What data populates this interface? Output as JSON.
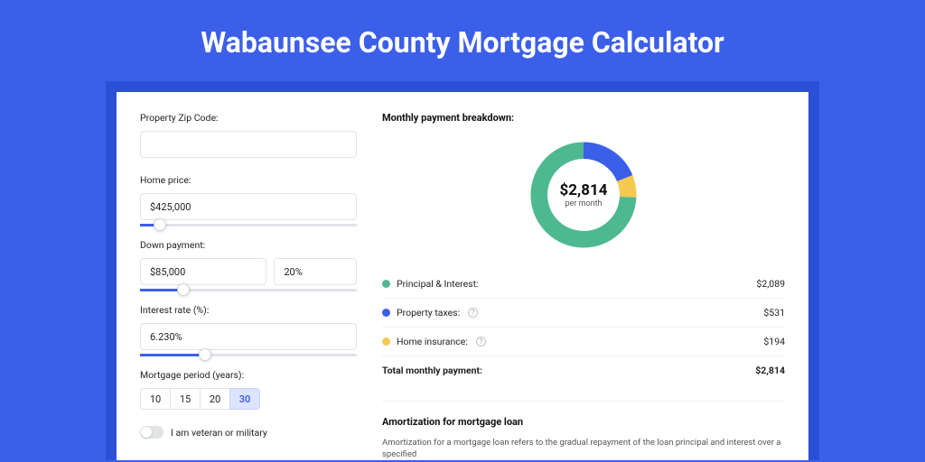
{
  "page_title": "Wabaunsee County Mortgage Calculator",
  "form": {
    "zip_label": "Property Zip Code:",
    "zip_value": "",
    "home_price_label": "Home price:",
    "home_price_value": "$425,000",
    "home_price_slider_pct": 9,
    "down_payment_label": "Down payment:",
    "down_payment_value": "$85,000",
    "down_payment_pct_value": "20%",
    "down_payment_slider_pct": 20,
    "interest_label": "Interest rate (%):",
    "interest_value": "6.230%",
    "interest_slider_pct": 30,
    "period_label": "Mortgage period (years):",
    "periods": [
      "10",
      "15",
      "20",
      "30"
    ],
    "period_selected": "30",
    "veteran_label": "I am veteran or military"
  },
  "breakdown": {
    "title": "Monthly payment breakdown:",
    "total_amount": "$2,814",
    "total_sub": "per month",
    "rows": [
      {
        "label": "Principal & Interest:",
        "value": "$2,089",
        "color": "#4EB891",
        "has_help": false
      },
      {
        "label": "Property taxes:",
        "value": "$531",
        "color": "#3B5FE8",
        "has_help": true
      },
      {
        "label": "Home insurance:",
        "value": "$194",
        "color": "#F4C94E",
        "has_help": true
      }
    ],
    "total_row_label": "Total monthly payment:",
    "total_row_value": "$2,814"
  },
  "chart_data": {
    "type": "pie",
    "title": "Monthly payment breakdown",
    "series": [
      {
        "name": "Principal & Interest",
        "value": 2089,
        "color": "#4EB891"
      },
      {
        "name": "Property taxes",
        "value": 531,
        "color": "#3B5FE8"
      },
      {
        "name": "Home insurance",
        "value": 194,
        "color": "#F4C94E"
      }
    ],
    "total": 2814,
    "center_label": "$2,814 per month"
  },
  "amort": {
    "title": "Amortization for mortgage loan",
    "text": "Amortization for a mortgage loan refers to the gradual repayment of the loan principal and interest over a specified"
  }
}
